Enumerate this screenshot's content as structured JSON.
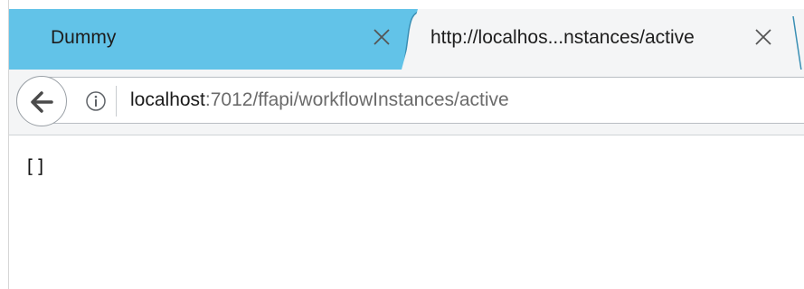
{
  "tabs": [
    {
      "title": "Dummy",
      "active": false,
      "close_icon": "close-icon"
    },
    {
      "title": "http://localhos...nstances/active",
      "active": true,
      "close_icon": "close-icon"
    }
  ],
  "toolbar": {
    "back_icon": "back-arrow-icon",
    "info_icon": "info-icon"
  },
  "address_bar": {
    "host": "localhost",
    "path": ":7012/ffapi/workflowInstances/active"
  },
  "page": {
    "body_text": "[]"
  },
  "colors": {
    "tabbar": "#62c3e8",
    "active_tab": "#f4f5f6",
    "url_host": "#1a1a1a",
    "url_path": "#6b6b6b"
  }
}
